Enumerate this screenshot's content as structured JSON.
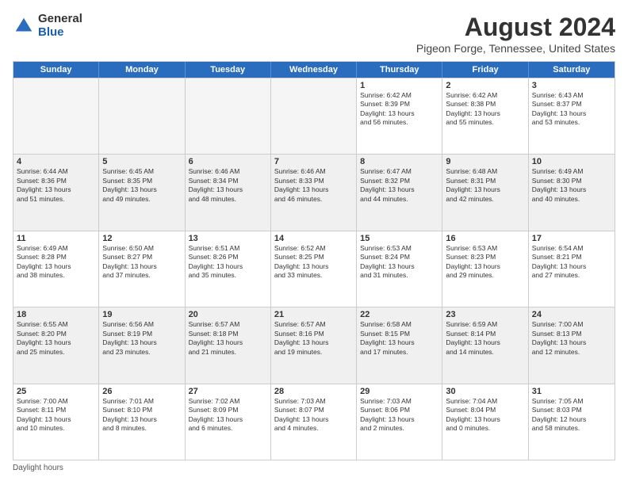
{
  "logo": {
    "general": "General",
    "blue": "Blue"
  },
  "title": "August 2024",
  "subtitle": "Pigeon Forge, Tennessee, United States",
  "days": [
    "Sunday",
    "Monday",
    "Tuesday",
    "Wednesday",
    "Thursday",
    "Friday",
    "Saturday"
  ],
  "footer": "Daylight hours",
  "weeks": [
    [
      {
        "num": "",
        "lines": [],
        "empty": true
      },
      {
        "num": "",
        "lines": [],
        "empty": true
      },
      {
        "num": "",
        "lines": [],
        "empty": true
      },
      {
        "num": "",
        "lines": [],
        "empty": true
      },
      {
        "num": "1",
        "lines": [
          "Sunrise: 6:42 AM",
          "Sunset: 8:39 PM",
          "Daylight: 13 hours",
          "and 56 minutes."
        ]
      },
      {
        "num": "2",
        "lines": [
          "Sunrise: 6:42 AM",
          "Sunset: 8:38 PM",
          "Daylight: 13 hours",
          "and 55 minutes."
        ]
      },
      {
        "num": "3",
        "lines": [
          "Sunrise: 6:43 AM",
          "Sunset: 8:37 PM",
          "Daylight: 13 hours",
          "and 53 minutes."
        ]
      }
    ],
    [
      {
        "num": "4",
        "lines": [
          "Sunrise: 6:44 AM",
          "Sunset: 8:36 PM",
          "Daylight: 13 hours",
          "and 51 minutes."
        ],
        "shaded": true
      },
      {
        "num": "5",
        "lines": [
          "Sunrise: 6:45 AM",
          "Sunset: 8:35 PM",
          "Daylight: 13 hours",
          "and 49 minutes."
        ],
        "shaded": true
      },
      {
        "num": "6",
        "lines": [
          "Sunrise: 6:46 AM",
          "Sunset: 8:34 PM",
          "Daylight: 13 hours",
          "and 48 minutes."
        ],
        "shaded": true
      },
      {
        "num": "7",
        "lines": [
          "Sunrise: 6:46 AM",
          "Sunset: 8:33 PM",
          "Daylight: 13 hours",
          "and 46 minutes."
        ],
        "shaded": true
      },
      {
        "num": "8",
        "lines": [
          "Sunrise: 6:47 AM",
          "Sunset: 8:32 PM",
          "Daylight: 13 hours",
          "and 44 minutes."
        ],
        "shaded": true
      },
      {
        "num": "9",
        "lines": [
          "Sunrise: 6:48 AM",
          "Sunset: 8:31 PM",
          "Daylight: 13 hours",
          "and 42 minutes."
        ],
        "shaded": true
      },
      {
        "num": "10",
        "lines": [
          "Sunrise: 6:49 AM",
          "Sunset: 8:30 PM",
          "Daylight: 13 hours",
          "and 40 minutes."
        ],
        "shaded": true
      }
    ],
    [
      {
        "num": "11",
        "lines": [
          "Sunrise: 6:49 AM",
          "Sunset: 8:28 PM",
          "Daylight: 13 hours",
          "and 38 minutes."
        ]
      },
      {
        "num": "12",
        "lines": [
          "Sunrise: 6:50 AM",
          "Sunset: 8:27 PM",
          "Daylight: 13 hours",
          "and 37 minutes."
        ]
      },
      {
        "num": "13",
        "lines": [
          "Sunrise: 6:51 AM",
          "Sunset: 8:26 PM",
          "Daylight: 13 hours",
          "and 35 minutes."
        ]
      },
      {
        "num": "14",
        "lines": [
          "Sunrise: 6:52 AM",
          "Sunset: 8:25 PM",
          "Daylight: 13 hours",
          "and 33 minutes."
        ]
      },
      {
        "num": "15",
        "lines": [
          "Sunrise: 6:53 AM",
          "Sunset: 8:24 PM",
          "Daylight: 13 hours",
          "and 31 minutes."
        ]
      },
      {
        "num": "16",
        "lines": [
          "Sunrise: 6:53 AM",
          "Sunset: 8:23 PM",
          "Daylight: 13 hours",
          "and 29 minutes."
        ]
      },
      {
        "num": "17",
        "lines": [
          "Sunrise: 6:54 AM",
          "Sunset: 8:21 PM",
          "Daylight: 13 hours",
          "and 27 minutes."
        ]
      }
    ],
    [
      {
        "num": "18",
        "lines": [
          "Sunrise: 6:55 AM",
          "Sunset: 8:20 PM",
          "Daylight: 13 hours",
          "and 25 minutes."
        ],
        "shaded": true
      },
      {
        "num": "19",
        "lines": [
          "Sunrise: 6:56 AM",
          "Sunset: 8:19 PM",
          "Daylight: 13 hours",
          "and 23 minutes."
        ],
        "shaded": true
      },
      {
        "num": "20",
        "lines": [
          "Sunrise: 6:57 AM",
          "Sunset: 8:18 PM",
          "Daylight: 13 hours",
          "and 21 minutes."
        ],
        "shaded": true
      },
      {
        "num": "21",
        "lines": [
          "Sunrise: 6:57 AM",
          "Sunset: 8:16 PM",
          "Daylight: 13 hours",
          "and 19 minutes."
        ],
        "shaded": true
      },
      {
        "num": "22",
        "lines": [
          "Sunrise: 6:58 AM",
          "Sunset: 8:15 PM",
          "Daylight: 13 hours",
          "and 17 minutes."
        ],
        "shaded": true
      },
      {
        "num": "23",
        "lines": [
          "Sunrise: 6:59 AM",
          "Sunset: 8:14 PM",
          "Daylight: 13 hours",
          "and 14 minutes."
        ],
        "shaded": true
      },
      {
        "num": "24",
        "lines": [
          "Sunrise: 7:00 AM",
          "Sunset: 8:13 PM",
          "Daylight: 13 hours",
          "and 12 minutes."
        ],
        "shaded": true
      }
    ],
    [
      {
        "num": "25",
        "lines": [
          "Sunrise: 7:00 AM",
          "Sunset: 8:11 PM",
          "Daylight: 13 hours",
          "and 10 minutes."
        ]
      },
      {
        "num": "26",
        "lines": [
          "Sunrise: 7:01 AM",
          "Sunset: 8:10 PM",
          "Daylight: 13 hours",
          "and 8 minutes."
        ]
      },
      {
        "num": "27",
        "lines": [
          "Sunrise: 7:02 AM",
          "Sunset: 8:09 PM",
          "Daylight: 13 hours",
          "and 6 minutes."
        ]
      },
      {
        "num": "28",
        "lines": [
          "Sunrise: 7:03 AM",
          "Sunset: 8:07 PM",
          "Daylight: 13 hours",
          "and 4 minutes."
        ]
      },
      {
        "num": "29",
        "lines": [
          "Sunrise: 7:03 AM",
          "Sunset: 8:06 PM",
          "Daylight: 13 hours",
          "and 2 minutes."
        ]
      },
      {
        "num": "30",
        "lines": [
          "Sunrise: 7:04 AM",
          "Sunset: 8:04 PM",
          "Daylight: 13 hours",
          "and 0 minutes."
        ]
      },
      {
        "num": "31",
        "lines": [
          "Sunrise: 7:05 AM",
          "Sunset: 8:03 PM",
          "Daylight: 12 hours",
          "and 58 minutes."
        ]
      }
    ]
  ]
}
